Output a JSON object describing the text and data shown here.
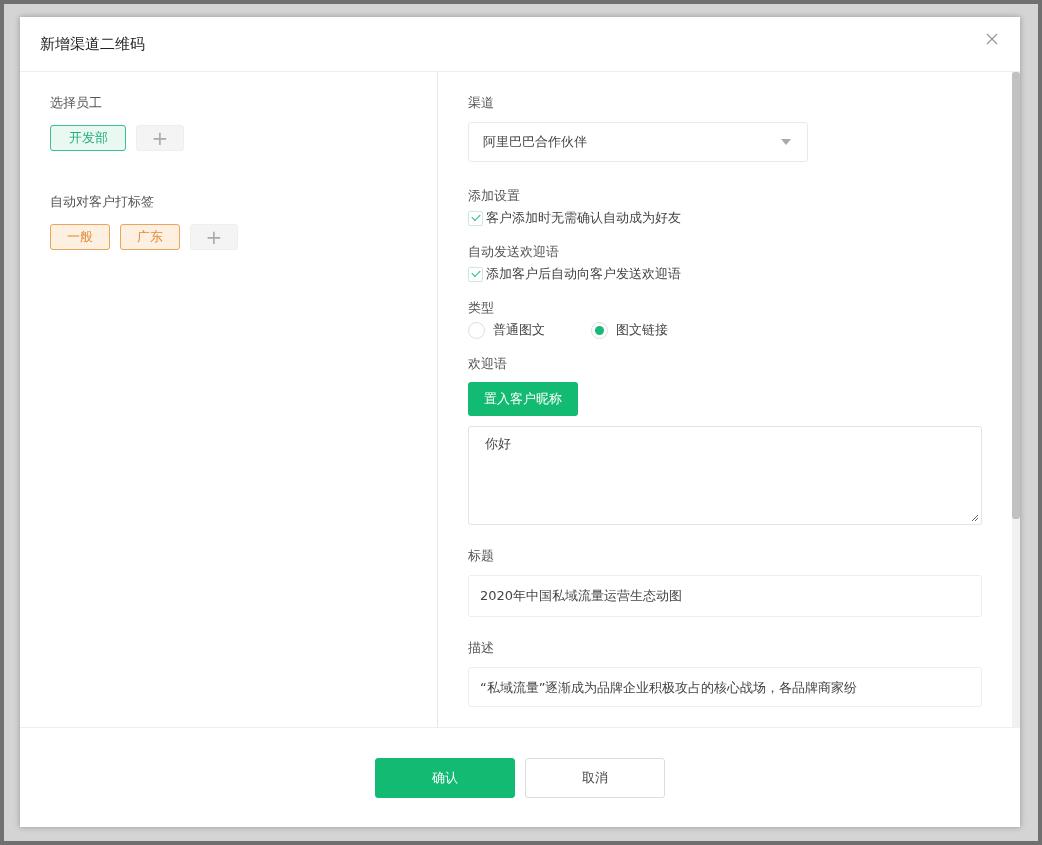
{
  "dialog": {
    "title": "新增渠道二维码"
  },
  "left": {
    "staff": {
      "label": "选择员工",
      "tags": [
        {
          "label": "开发部"
        }
      ],
      "add": "+"
    },
    "customer_tags": {
      "label": "自动对客户打标签",
      "tags": [
        {
          "label": "一般"
        },
        {
          "label": "广东"
        }
      ],
      "add": "+"
    }
  },
  "right": {
    "channel": {
      "label": "渠道",
      "value": "阿里巴巴合作伙伴"
    },
    "add_settings": {
      "label": "添加设置",
      "option": {
        "label": "客户添加时无需确认自动成为好友",
        "checked": true
      }
    },
    "auto_welcome": {
      "label": "自动发送欢迎语",
      "option": {
        "label": "添加客户后自动向客户发送欢迎语",
        "checked": true
      }
    },
    "type": {
      "label": "类型",
      "options": [
        {
          "label": "普通图文",
          "selected": false
        },
        {
          "label": "图文链接",
          "selected": true
        }
      ]
    },
    "welcome": {
      "label": "欢迎语",
      "insert_button": "置入客户昵称",
      "value": "你好"
    },
    "title": {
      "label": "标题",
      "value": "2020年中国私域流量运营生态动图"
    },
    "description": {
      "label": "描述",
      "value": "“私域流量”逐渐成为品牌企业积极攻占的核心战场，各品牌商家纷"
    }
  },
  "buttons": [
    "确认",
    "取消"
  ]
}
